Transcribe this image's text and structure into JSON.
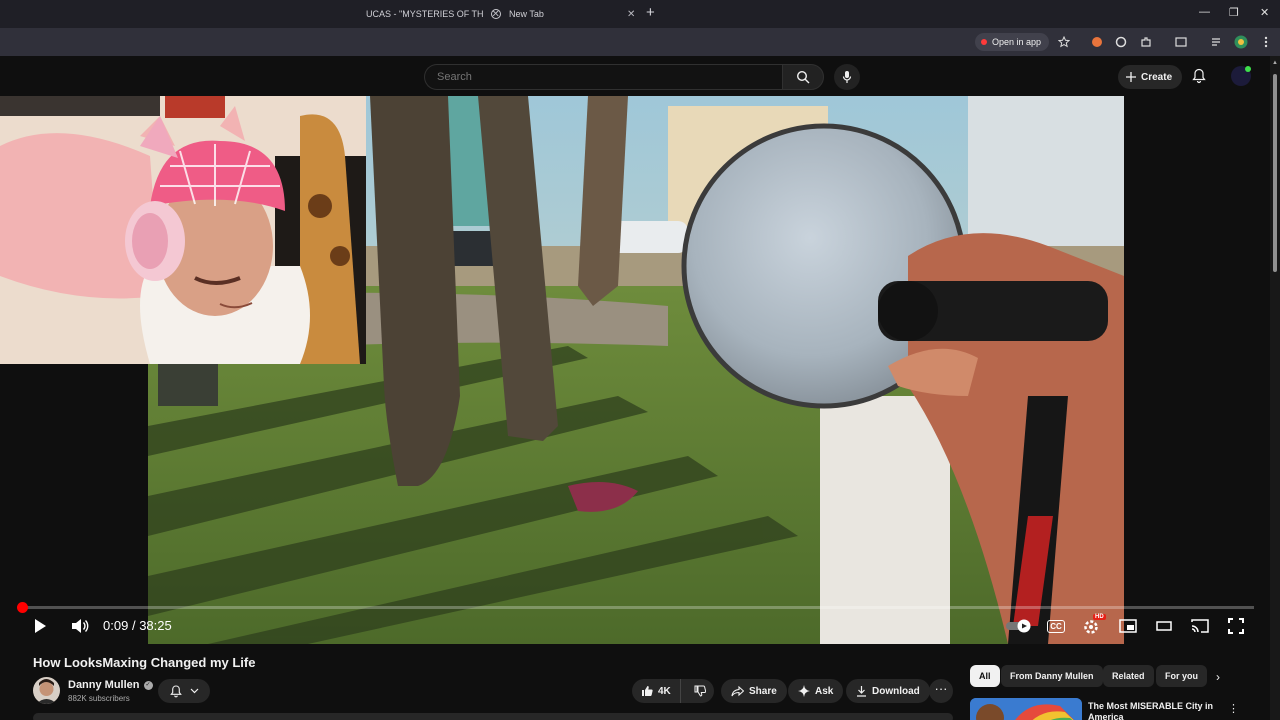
{
  "browser": {
    "tabs": [
      {
        "title": "UCAS - \"MYSTERIES OF TH",
        "close": "✕"
      },
      {
        "title": "New Tab",
        "close": "✕"
      }
    ],
    "new_tab": "+",
    "window_controls": {
      "minimize": "—",
      "restore": "❐",
      "close": "✕"
    },
    "open_in_app": "Open in app"
  },
  "youtube_header": {
    "search_placeholder": "Search",
    "create_label": "Create"
  },
  "player": {
    "progress_fraction": 0.0039,
    "time_current": "0:09",
    "time_separator": "/",
    "time_total": "38:25",
    "cc_label": "CC",
    "hd_badge": "HD"
  },
  "video": {
    "title": "How LooksMaxing Changed my Life",
    "channel_name": "Danny Mullen",
    "subscribers": "882K subscribers",
    "likes": "4K",
    "share_label": "Share",
    "ask_label": "Ask",
    "download_label": "Download",
    "more": "···"
  },
  "sidebar": {
    "chips": [
      "All",
      "From Danny Mullen",
      "Related",
      "For you"
    ],
    "next_chevron": "›",
    "rec_title": "The Most MISERABLE City in America",
    "rec_more": "⋮"
  },
  "colors": {
    "background": "#0f0f0f",
    "progress": "#ff0000",
    "chip_active": "#f1f1f1",
    "pill": "#272727"
  }
}
